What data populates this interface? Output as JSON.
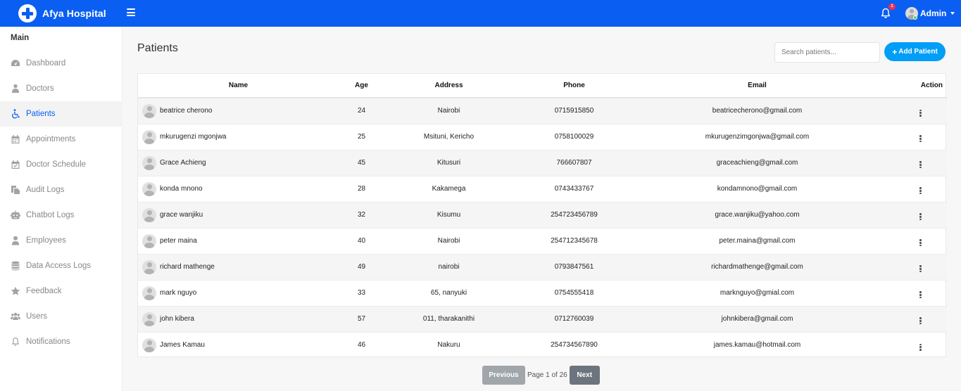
{
  "header": {
    "brand": "Afya Hospital",
    "notification_count": "1",
    "user_name": "Admin"
  },
  "sidebar": {
    "title": "Main",
    "items": [
      {
        "label": "Dashboard",
        "icon": "dashboard-icon"
      },
      {
        "label": "Doctors",
        "icon": "doctor-icon"
      },
      {
        "label": "Patients",
        "icon": "wheelchair-icon",
        "active": true
      },
      {
        "label": "Appointments",
        "icon": "calendar-icon"
      },
      {
        "label": "Doctor Schedule",
        "icon": "calendar-check-icon"
      },
      {
        "label": "Audit Logs",
        "icon": "copy-icon"
      },
      {
        "label": "Chatbot Logs",
        "icon": "robot-icon"
      },
      {
        "label": "Employees",
        "icon": "user-icon"
      },
      {
        "label": "Data Access Logs",
        "icon": "database-icon"
      },
      {
        "label": "Feedback",
        "icon": "star-icon"
      },
      {
        "label": "Users",
        "icon": "users-icon"
      },
      {
        "label": "Notifications",
        "icon": "bell-icon"
      }
    ]
  },
  "main": {
    "title": "Patients",
    "search_placeholder": "Search patients...",
    "add_label": "Add Patient",
    "columns": [
      "Name",
      "Age",
      "Address",
      "Phone",
      "Email",
      "Action"
    ],
    "rows": [
      {
        "name": "beatrice cherono",
        "age": "24",
        "address": "Nairobi",
        "phone": "0715915850",
        "email": "beatricecherono@gmail.com"
      },
      {
        "name": "mkurugenzi mgonjwa",
        "age": "25",
        "address": "Msituni, Kericho",
        "phone": "0758100029",
        "email": "mkurugenzimgonjwa@gmail.com"
      },
      {
        "name": "Grace Achieng",
        "age": "45",
        "address": "Kitusuri",
        "phone": "766607807",
        "email": "graceachieng@gmail.com"
      },
      {
        "name": "konda mnono",
        "age": "28",
        "address": "Kakamega",
        "phone": "0743433767",
        "email": "kondamnono@gmail.com"
      },
      {
        "name": "grace wanjiku",
        "age": "32",
        "address": "Kisumu",
        "phone": "254723456789",
        "email": "grace.wanjiku@yahoo.com"
      },
      {
        "name": "peter maina",
        "age": "40",
        "address": "Nairobi",
        "phone": "254712345678",
        "email": "peter.maina@gmail.com"
      },
      {
        "name": "richard mathenge",
        "age": "49",
        "address": "nairobi",
        "phone": "0793847561",
        "email": "richardmathenge@gmail.com"
      },
      {
        "name": "mark nguyo",
        "age": "33",
        "address": "65, nanyuki",
        "phone": "0754555418",
        "email": "marknguyo@gmial.com"
      },
      {
        "name": "john kibera",
        "age": "57",
        "address": "011, tharakanithi",
        "phone": "0712760039",
        "email": "johnkibera@gmail.com"
      },
      {
        "name": "James Kamau",
        "age": "46",
        "address": "Nakuru",
        "phone": "254734567890",
        "email": "james.kamau@hotmail.com"
      }
    ]
  },
  "pagination": {
    "prev_label": "Previous",
    "page_text": "Page 1 of 26",
    "next_label": "Next"
  },
  "colors": {
    "primary": "#0a5ff2",
    "accent": "#009ef7",
    "badge": "#f62d51",
    "online": "#55ce63"
  }
}
